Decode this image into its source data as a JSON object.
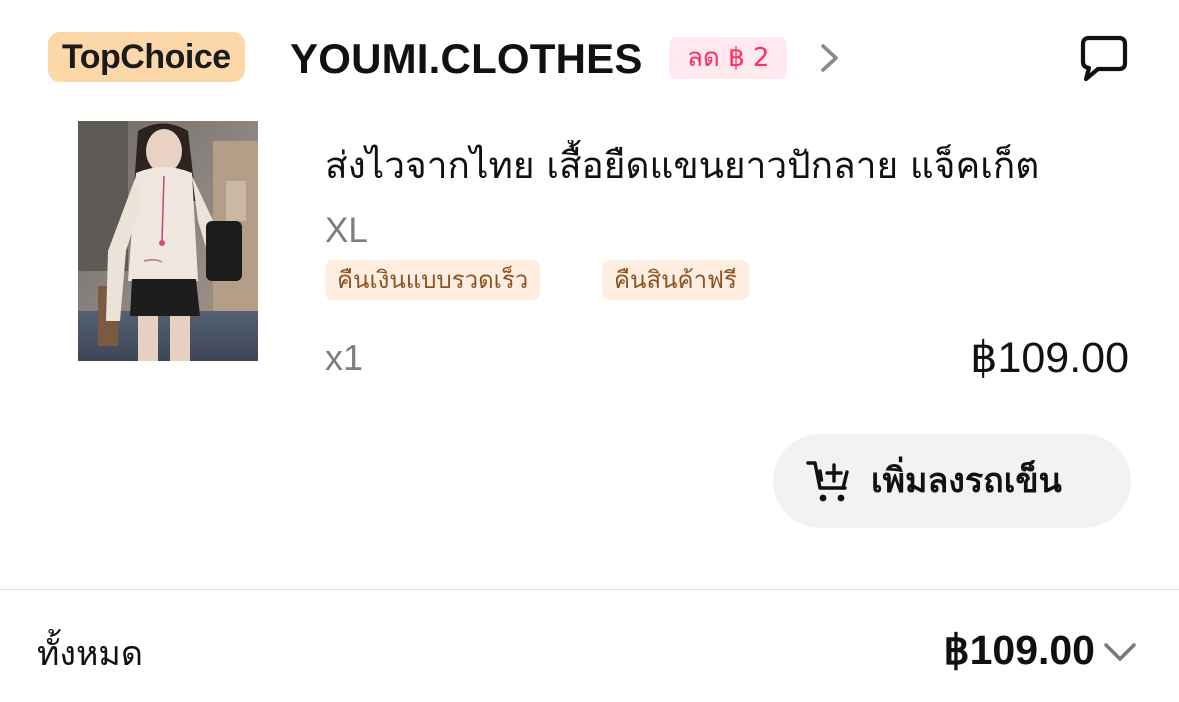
{
  "shop": {
    "badge": "TopChoice",
    "name": "YOUMI.CLOTHES",
    "discount_label": "ลด ฿ 2"
  },
  "item": {
    "image_icon": "product-photo",
    "title": "ส่งไวจากไทย เสื้อยืดแขนยาวปักลาย แจ็คเก็ต",
    "variant": "XL",
    "tags": [
      "คืนเงินแบบรวดเร็ว",
      "คืนสินค้าฟรี"
    ],
    "quantity": "x1",
    "price": "฿109.00"
  },
  "actions": {
    "add_to_cart_label": "เพิ่มลงรถเข็น",
    "add_to_cart_icon": "cart-plus-icon"
  },
  "summary": {
    "total_label": "ทั้งหมด",
    "total_value": "฿109.00"
  },
  "colors": {
    "topchoice_bg": "#fcd8a8",
    "discount_text": "#ff2e61",
    "discount_bg": "#ffe9ef",
    "tag_text": "#8c5423",
    "tag_bg": "#fdeee1",
    "button_bg": "#f2f2f2"
  }
}
